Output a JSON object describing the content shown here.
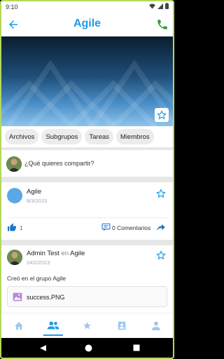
{
  "status": {
    "time": "9:10"
  },
  "header": {
    "title": "Agile"
  },
  "tabs": [
    "Archivos",
    "Subgrupos",
    "Tareas",
    "Miembros"
  ],
  "composer": {
    "placeholder": "¿Qué quieres compartir?"
  },
  "post1": {
    "name": "Agile",
    "date": "8/3/2023",
    "likes": "1",
    "comments": "0 Comentarios"
  },
  "post2": {
    "author": "Admin Test",
    "connector": "en",
    "group": "Agile",
    "date": "24/2/2023",
    "body": "Creó en el grupo Agile",
    "attachment": "success.PNG"
  },
  "colors": {
    "accent": "#1e9be6",
    "phone": "#2e9d3a"
  },
  "icons": {
    "back": "arrow-left-icon",
    "phone": "phone-icon",
    "star": "star-outline-icon",
    "like": "thumb-up-icon",
    "comment": "comment-icon",
    "share": "share-arrow-icon",
    "image": "image-icon"
  },
  "bottom_nav": [
    "home-icon",
    "group-icon",
    "star-icon",
    "contacts-icon",
    "person-icon"
  ]
}
